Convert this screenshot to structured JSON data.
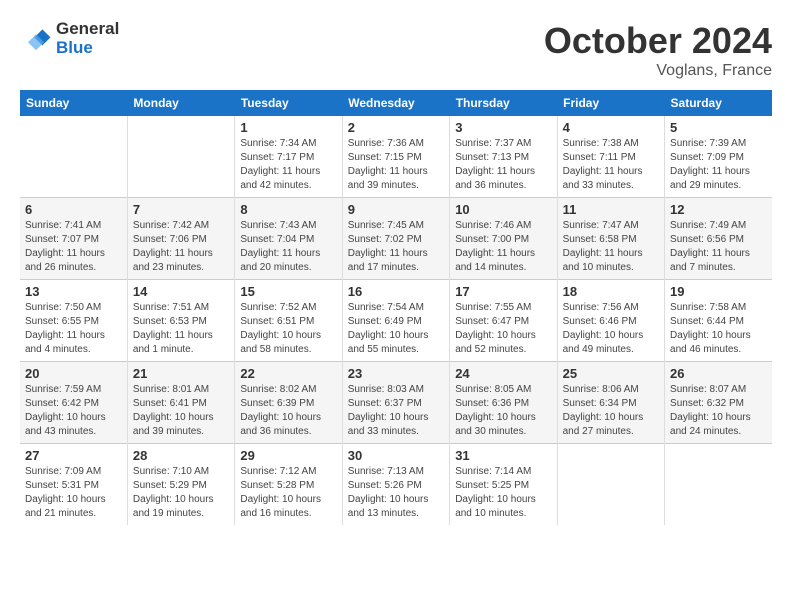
{
  "header": {
    "logo_line1": "General",
    "logo_line2": "Blue",
    "month": "October 2024",
    "location": "Voglans, France"
  },
  "days_of_week": [
    "Sunday",
    "Monday",
    "Tuesday",
    "Wednesday",
    "Thursday",
    "Friday",
    "Saturday"
  ],
  "weeks": [
    [
      {
        "num": "",
        "info": ""
      },
      {
        "num": "",
        "info": ""
      },
      {
        "num": "1",
        "info": "Sunrise: 7:34 AM\nSunset: 7:17 PM\nDaylight: 11 hours and 42 minutes."
      },
      {
        "num": "2",
        "info": "Sunrise: 7:36 AM\nSunset: 7:15 PM\nDaylight: 11 hours and 39 minutes."
      },
      {
        "num": "3",
        "info": "Sunrise: 7:37 AM\nSunset: 7:13 PM\nDaylight: 11 hours and 36 minutes."
      },
      {
        "num": "4",
        "info": "Sunrise: 7:38 AM\nSunset: 7:11 PM\nDaylight: 11 hours and 33 minutes."
      },
      {
        "num": "5",
        "info": "Sunrise: 7:39 AM\nSunset: 7:09 PM\nDaylight: 11 hours and 29 minutes."
      }
    ],
    [
      {
        "num": "6",
        "info": "Sunrise: 7:41 AM\nSunset: 7:07 PM\nDaylight: 11 hours and 26 minutes."
      },
      {
        "num": "7",
        "info": "Sunrise: 7:42 AM\nSunset: 7:06 PM\nDaylight: 11 hours and 23 minutes."
      },
      {
        "num": "8",
        "info": "Sunrise: 7:43 AM\nSunset: 7:04 PM\nDaylight: 11 hours and 20 minutes."
      },
      {
        "num": "9",
        "info": "Sunrise: 7:45 AM\nSunset: 7:02 PM\nDaylight: 11 hours and 17 minutes."
      },
      {
        "num": "10",
        "info": "Sunrise: 7:46 AM\nSunset: 7:00 PM\nDaylight: 11 hours and 14 minutes."
      },
      {
        "num": "11",
        "info": "Sunrise: 7:47 AM\nSunset: 6:58 PM\nDaylight: 11 hours and 10 minutes."
      },
      {
        "num": "12",
        "info": "Sunrise: 7:49 AM\nSunset: 6:56 PM\nDaylight: 11 hours and 7 minutes."
      }
    ],
    [
      {
        "num": "13",
        "info": "Sunrise: 7:50 AM\nSunset: 6:55 PM\nDaylight: 11 hours and 4 minutes."
      },
      {
        "num": "14",
        "info": "Sunrise: 7:51 AM\nSunset: 6:53 PM\nDaylight: 11 hours and 1 minute."
      },
      {
        "num": "15",
        "info": "Sunrise: 7:52 AM\nSunset: 6:51 PM\nDaylight: 10 hours and 58 minutes."
      },
      {
        "num": "16",
        "info": "Sunrise: 7:54 AM\nSunset: 6:49 PM\nDaylight: 10 hours and 55 minutes."
      },
      {
        "num": "17",
        "info": "Sunrise: 7:55 AM\nSunset: 6:47 PM\nDaylight: 10 hours and 52 minutes."
      },
      {
        "num": "18",
        "info": "Sunrise: 7:56 AM\nSunset: 6:46 PM\nDaylight: 10 hours and 49 minutes."
      },
      {
        "num": "19",
        "info": "Sunrise: 7:58 AM\nSunset: 6:44 PM\nDaylight: 10 hours and 46 minutes."
      }
    ],
    [
      {
        "num": "20",
        "info": "Sunrise: 7:59 AM\nSunset: 6:42 PM\nDaylight: 10 hours and 43 minutes."
      },
      {
        "num": "21",
        "info": "Sunrise: 8:01 AM\nSunset: 6:41 PM\nDaylight: 10 hours and 39 minutes."
      },
      {
        "num": "22",
        "info": "Sunrise: 8:02 AM\nSunset: 6:39 PM\nDaylight: 10 hours and 36 minutes."
      },
      {
        "num": "23",
        "info": "Sunrise: 8:03 AM\nSunset: 6:37 PM\nDaylight: 10 hours and 33 minutes."
      },
      {
        "num": "24",
        "info": "Sunrise: 8:05 AM\nSunset: 6:36 PM\nDaylight: 10 hours and 30 minutes."
      },
      {
        "num": "25",
        "info": "Sunrise: 8:06 AM\nSunset: 6:34 PM\nDaylight: 10 hours and 27 minutes."
      },
      {
        "num": "26",
        "info": "Sunrise: 8:07 AM\nSunset: 6:32 PM\nDaylight: 10 hours and 24 minutes."
      }
    ],
    [
      {
        "num": "27",
        "info": "Sunrise: 7:09 AM\nSunset: 5:31 PM\nDaylight: 10 hours and 21 minutes."
      },
      {
        "num": "28",
        "info": "Sunrise: 7:10 AM\nSunset: 5:29 PM\nDaylight: 10 hours and 19 minutes."
      },
      {
        "num": "29",
        "info": "Sunrise: 7:12 AM\nSunset: 5:28 PM\nDaylight: 10 hours and 16 minutes."
      },
      {
        "num": "30",
        "info": "Sunrise: 7:13 AM\nSunset: 5:26 PM\nDaylight: 10 hours and 13 minutes."
      },
      {
        "num": "31",
        "info": "Sunrise: 7:14 AM\nSunset: 5:25 PM\nDaylight: 10 hours and 10 minutes."
      },
      {
        "num": "",
        "info": ""
      },
      {
        "num": "",
        "info": ""
      }
    ]
  ]
}
